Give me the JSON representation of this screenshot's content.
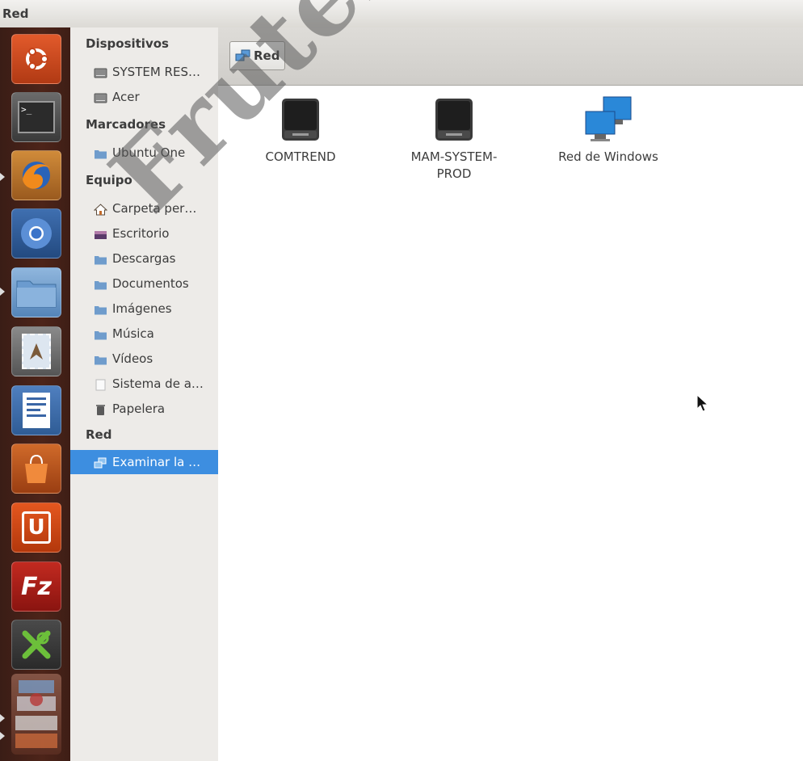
{
  "window": {
    "title": "Red"
  },
  "launcher": {
    "items": [
      {
        "name": "ubuntu-dash-icon"
      },
      {
        "name": "terminal-icon"
      },
      {
        "name": "firefox-icon"
      },
      {
        "name": "chromium-icon"
      },
      {
        "name": "files-icon"
      },
      {
        "name": "mail-icon"
      },
      {
        "name": "libreoffice-writer-icon"
      },
      {
        "name": "software-center-icon"
      },
      {
        "name": "ubuntu-one-icon"
      },
      {
        "name": "filezilla-icon"
      },
      {
        "name": "xfig-icon"
      },
      {
        "name": "stacked-apps-icon"
      }
    ]
  },
  "sidebar": {
    "sections": [
      {
        "heading": "Dispositivos",
        "items": [
          {
            "label": "SYSTEM RES…",
            "icon": "drive-icon"
          },
          {
            "label": "Acer",
            "icon": "drive-icon"
          }
        ]
      },
      {
        "heading": "Marcadores",
        "items": [
          {
            "label": "Ubuntu One",
            "icon": "folder-icon"
          }
        ]
      },
      {
        "heading": "Equipo",
        "items": [
          {
            "label": "Carpeta per…",
            "icon": "home-icon"
          },
          {
            "label": "Escritorio",
            "icon": "desktop-icon"
          },
          {
            "label": "Descargas",
            "icon": "folder-icon"
          },
          {
            "label": "Documentos",
            "icon": "folder-icon"
          },
          {
            "label": "Imágenes",
            "icon": "folder-icon"
          },
          {
            "label": "Música",
            "icon": "folder-icon"
          },
          {
            "label": "Vídeos",
            "icon": "folder-icon"
          },
          {
            "label": "Sistema de a…",
            "icon": "file-icon"
          },
          {
            "label": "Papelera",
            "icon": "trash-icon"
          }
        ]
      },
      {
        "heading": "Red",
        "items": [
          {
            "label": "Examinar la …",
            "icon": "network-icon",
            "selected": true
          }
        ]
      }
    ]
  },
  "toolbar": {
    "path_label": "Red"
  },
  "content": {
    "items": [
      {
        "label": "COMTREND",
        "icon": "network-drive-icon"
      },
      {
        "label": "MAM-SYSTEM-PROD",
        "icon": "network-drive-icon"
      },
      {
        "label": "Red de Windows",
        "icon": "windows-network-icon"
      }
    ]
  },
  "watermark": {
    "text": "Fruterolo"
  },
  "colors": {
    "selection": "#3d8ee0",
    "launcher": "#4d2419",
    "sidebar": "#edebe8"
  }
}
